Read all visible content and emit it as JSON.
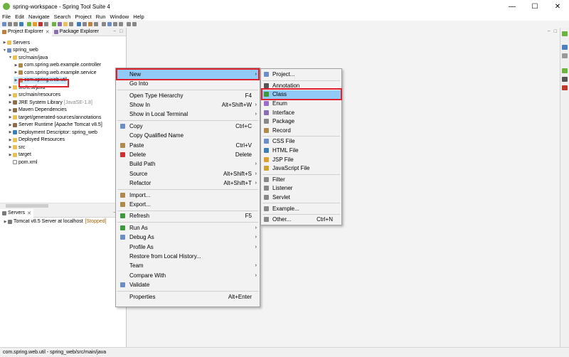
{
  "window": {
    "title": "spring-workspace - Spring Tool Suite 4",
    "minimize": "—",
    "maximize": "☐",
    "close": "✕"
  },
  "menubar": [
    "File",
    "Edit",
    "Navigate",
    "Search",
    "Project",
    "Run",
    "Window",
    "Help"
  ],
  "left_panel": {
    "tabs": [
      {
        "label": "Project Explorer",
        "active": true
      },
      {
        "label": "Package Explorer",
        "active": false
      }
    ],
    "tree": [
      {
        "label": "Servers",
        "level": 0,
        "icon": "folder-icon",
        "expanded": false
      },
      {
        "label": "spring_web",
        "level": 0,
        "icon": "project-icon",
        "expanded": true
      },
      {
        "label": "src/main/java",
        "level": 1,
        "icon": "source-folder-icon",
        "expanded": true
      },
      {
        "label": "com.spring.web.example.controller",
        "level": 2,
        "icon": "package-icon",
        "expanded": false
      },
      {
        "label": "com.spring.web.example.service",
        "level": 2,
        "icon": "package-icon",
        "expanded": false
      },
      {
        "label": "com.spring.web.util",
        "level": 2,
        "icon": "package-icon",
        "expanded": false,
        "selected": true
      },
      {
        "label": "src/test/java",
        "level": 1,
        "icon": "source-folder-icon",
        "expanded": false
      },
      {
        "label": "src/main/resources",
        "level": 1,
        "icon": "source-folder-icon",
        "expanded": false
      },
      {
        "label": "JRE System Library",
        "suffix": "[JavaSE-1.8]",
        "level": 1,
        "icon": "library-icon",
        "expanded": false
      },
      {
        "label": "Maven Dependencies",
        "level": 1,
        "icon": "library-icon",
        "expanded": false
      },
      {
        "label": "target/generated-sources/annotations",
        "level": 1,
        "icon": "source-folder-icon",
        "expanded": false
      },
      {
        "label": "Server Runtime [Apache Tomcat v8.5]",
        "level": 1,
        "icon": "library-icon",
        "expanded": false
      },
      {
        "label": "Deployment Descriptor: spring_web",
        "level": 1,
        "icon": "deployment-icon",
        "expanded": false
      },
      {
        "label": "Deployed Resources",
        "level": 1,
        "icon": "folder-icon",
        "expanded": false
      },
      {
        "label": "src",
        "level": 1,
        "icon": "folder-icon",
        "expanded": false
      },
      {
        "label": "target",
        "level": 1,
        "icon": "folder-icon",
        "expanded": false
      },
      {
        "label": "pom.xml",
        "level": 1,
        "icon": "xml-file-icon",
        "expanded": null
      }
    ]
  },
  "servers_panel": {
    "tab": "Servers",
    "row": {
      "label": "Tomcat v8.5 Server at localhost",
      "status": "[Stopped]"
    }
  },
  "context_menu": {
    "items": [
      {
        "label": "New",
        "submenu": true,
        "highlighted": true
      },
      {
        "label": "Go Into"
      },
      {
        "sep": true
      },
      {
        "label": "Open Type Hierarchy",
        "shortcut": "F4"
      },
      {
        "label": "Show In",
        "shortcut": "Alt+Shift+W",
        "submenu": true
      },
      {
        "label": "Show in Local Terminal",
        "submenu": true
      },
      {
        "sep": true
      },
      {
        "label": "Copy",
        "shortcut": "Ctrl+C",
        "icon": "copy-icon"
      },
      {
        "label": "Copy Qualified Name"
      },
      {
        "label": "Paste",
        "shortcut": "Ctrl+V",
        "icon": "paste-icon"
      },
      {
        "label": "Delete",
        "shortcut": "Delete",
        "icon": "delete-icon"
      },
      {
        "label": "Build Path",
        "submenu": true
      },
      {
        "label": "Source",
        "shortcut": "Alt+Shift+S",
        "submenu": true
      },
      {
        "label": "Refactor",
        "shortcut": "Alt+Shift+T",
        "submenu": true
      },
      {
        "sep": true
      },
      {
        "label": "Import...",
        "icon": "import-icon"
      },
      {
        "label": "Export...",
        "icon": "export-icon"
      },
      {
        "sep": true
      },
      {
        "label": "Refresh",
        "shortcut": "F5",
        "icon": "refresh-icon"
      },
      {
        "sep": true
      },
      {
        "label": "Run As",
        "submenu": true,
        "icon": "run-icon"
      },
      {
        "label": "Debug As",
        "submenu": true,
        "icon": "debug-icon"
      },
      {
        "label": "Profile As",
        "submenu": true
      },
      {
        "label": "Restore from Local History..."
      },
      {
        "label": "Team",
        "submenu": true
      },
      {
        "label": "Compare With",
        "submenu": true
      },
      {
        "label": "Validate",
        "icon": "checkbox-icon"
      },
      {
        "sep": true
      },
      {
        "label": "Properties",
        "shortcut": "Alt+Enter"
      }
    ]
  },
  "new_submenu": {
    "items": [
      {
        "label": "Project...",
        "icon": "new-project-icon"
      },
      {
        "sep": true
      },
      {
        "label": "Annotation",
        "icon": "annotation-icon"
      },
      {
        "label": "Class",
        "icon": "class-icon",
        "highlighted": true
      },
      {
        "label": "Enum",
        "icon": "enum-icon"
      },
      {
        "label": "Interface",
        "icon": "interface-icon"
      },
      {
        "label": "Package",
        "icon": "package-icon"
      },
      {
        "label": "Record",
        "icon": "record-icon"
      },
      {
        "sep": true
      },
      {
        "label": "CSS File",
        "icon": "css-file-icon"
      },
      {
        "label": "HTML File",
        "icon": "html-file-icon"
      },
      {
        "label": "JSP File",
        "icon": "jsp-file-icon"
      },
      {
        "label": "JavaScript File",
        "icon": "js-file-icon"
      },
      {
        "sep": true
      },
      {
        "label": "Filter",
        "icon": "filter-icon"
      },
      {
        "label": "Listener",
        "icon": "listener-icon"
      },
      {
        "label": "Servlet",
        "icon": "servlet-icon"
      },
      {
        "sep": true
      },
      {
        "label": "Example...",
        "icon": "example-icon"
      },
      {
        "sep": true
      },
      {
        "label": "Other...",
        "shortcut": "Ctrl+N",
        "icon": "other-icon"
      }
    ]
  },
  "statusbar": {
    "text": "com.spring.web.util - spring_web/src/main/java"
  },
  "colors": {
    "highlight": "#91c9f7",
    "annotation_red": "#e0202a",
    "spring_green": "#6db33f"
  }
}
